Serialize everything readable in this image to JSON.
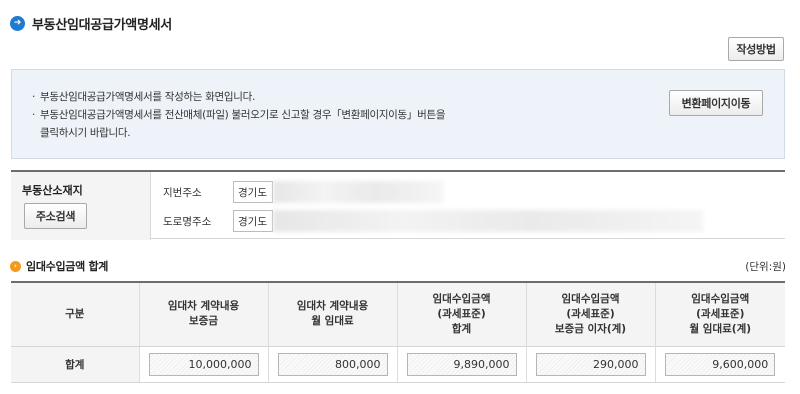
{
  "page": {
    "title": "부동산임대공급가액명세서",
    "how_to_button": "작성방법"
  },
  "notice": {
    "lines": [
      "부동산임대공급가액명세서를 작성하는 화면입니다.",
      "부동산임대공급가액명세서를 전산매체(파일) 불러오기로 신고할 경우「변환페이지이동」버튼을",
      "클릭하시기 바랍니다."
    ],
    "convert_button": "변환페이지이동"
  },
  "address": {
    "label": "부동산소재지",
    "search_button": "주소검색",
    "lot_label": "지번주소",
    "lot_value": "경기도",
    "road_label": "도로명주소",
    "road_value": "경기도"
  },
  "summary": {
    "title": "임대수입금액 합계",
    "unit": "(단위:원)",
    "headers": [
      [
        "구분"
      ],
      [
        "임대차 계약내용",
        "보증금"
      ],
      [
        "임대차 계약내용",
        "월 임대료"
      ],
      [
        "임대수입금액",
        "(과세표준)",
        "합계"
      ],
      [
        "임대수입금액",
        "(과세표준)",
        "보증금 이자(계)"
      ],
      [
        "임대수입금액",
        "(과세표준)",
        "월 임대료(계)"
      ]
    ],
    "row_label": "합계",
    "values": [
      "10,000,000",
      "800,000",
      "9,890,000",
      "290,000",
      "9,600,000"
    ]
  },
  "colors": {
    "title_icon": "#1f7bd1",
    "sub_icon": "#f39a1e",
    "notice_bg": "#edf3f9"
  },
  "icons": {
    "title": "arrow-circle-icon",
    "sub": "arrow-circle-small-icon"
  }
}
